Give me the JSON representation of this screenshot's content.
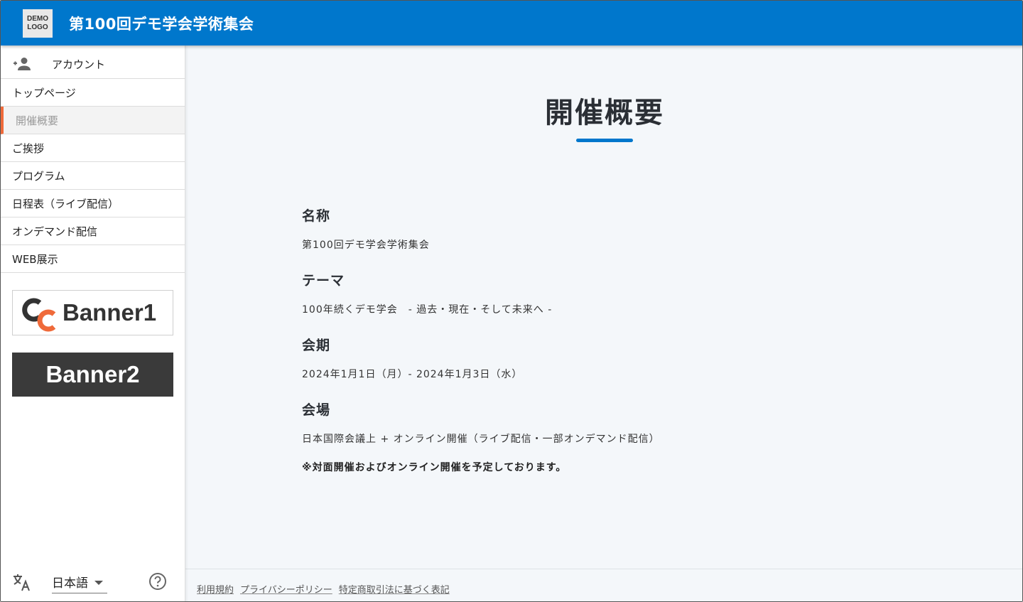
{
  "header": {
    "logo_line1": "DEMO",
    "logo_line2": "LOGO",
    "site_title": "第100回デモ学会学術集会",
    "bar_color": "#0077cc"
  },
  "sidebar": {
    "account_label": "アカウント",
    "items": [
      {
        "label": "トップページ",
        "active": false
      },
      {
        "label": "開催概要",
        "active": true
      },
      {
        "label": "ご挨拶",
        "active": false
      },
      {
        "label": "プログラム",
        "active": false
      },
      {
        "label": "日程表（ライブ配信）",
        "active": false
      },
      {
        "label": "オンデマンド配信",
        "active": false
      },
      {
        "label": "WEB展示",
        "active": false
      }
    ],
    "active_accent": "#ef6a3a",
    "banner1_label": "Banner1",
    "banner2_label": "Banner2",
    "language_value": "日本語",
    "icons": [
      "person-add-icon",
      "translate-icon",
      "chevron-down-icon",
      "help-circle-icon"
    ]
  },
  "main": {
    "page_title": "開催概要",
    "sections": [
      {
        "heading": "名称",
        "body": "第100回デモ学会学術集会"
      },
      {
        "heading": "テーマ",
        "body": "100年続くデモ学会　- 過去・現在・そして未来へ -"
      },
      {
        "heading": "会期",
        "body": "2024年1月1日（月）- 2024年1月3日（水）"
      },
      {
        "heading": "会場",
        "body": "日本国際会議上 + オンライン開催（ライブ配信・一部オンデマンド配信）"
      }
    ],
    "note": "※対面開催およびオンライン開催を予定しております。"
  },
  "footer": {
    "links": [
      "利用規約",
      "プライバシーポリシー",
      "特定商取引法に基づく表記"
    ]
  }
}
